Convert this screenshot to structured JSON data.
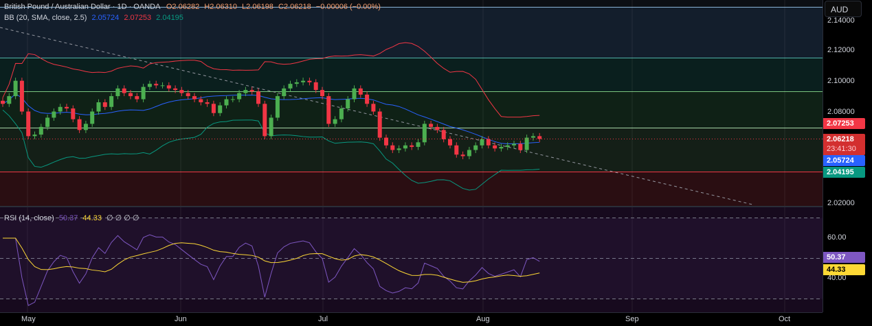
{
  "legend": {
    "title": "British Pound / Australian Dollar · 1D · OANDA",
    "open": "O2.06282",
    "high": "H2.06310",
    "low": "L2.06198",
    "close": "C2.06218",
    "change": "−0.00006 (−0.00%)",
    "bb_label": "BB (20, SMA, close, 2.5)",
    "bb_basis": "2.05724",
    "bb_upper": "2.07253",
    "bb_lower": "2.04195",
    "rsi_label": "RSI (14, close)",
    "rsi_value": "50.37",
    "rsi_ma": "44.33",
    "rsi_extra": "∅ ∅ ∅ ∅"
  },
  "currency_button": "AUD",
  "price_ticks": [
    "2.14000",
    "2.12000",
    "2.10000",
    "2.08000",
    "2.02000"
  ],
  "price_labels": {
    "upper": "2.07253",
    "last": "2.06218",
    "countdown": "23:41:30",
    "basis": "2.05724",
    "lower": "2.04195"
  },
  "rsi_ticks": [
    "60.00",
    "40.00"
  ],
  "rsi_labels": {
    "rsi": "50.37",
    "ma": "44.33"
  },
  "time_ticks": [
    "May",
    "Jun",
    "Jul",
    "Aug",
    "Sep",
    "Oct"
  ],
  "colors": {
    "up": "#4caf50",
    "down": "#f23645",
    "basis": "#2962ff",
    "upper": "#f23645",
    "lower": "#089981",
    "rsi": "#7e57c2",
    "rsi_ma": "#fdd835"
  },
  "closes": [
    2.085,
    2.09,
    2.1,
    2.08,
    2.064,
    2.065,
    2.07,
    2.076,
    2.08,
    2.083,
    2.082,
    2.075,
    2.068,
    2.072,
    2.08,
    2.086,
    2.083,
    2.09,
    2.095,
    2.092,
    2.09,
    2.088,
    2.096,
    2.098,
    2.097,
    2.097,
    2.095,
    2.094,
    2.092,
    2.09,
    2.088,
    2.086,
    2.085,
    2.079,
    2.084,
    2.088,
    2.088,
    2.092,
    2.094,
    2.093,
    2.085,
    2.064,
    2.076,
    2.09,
    2.095,
    2.098,
    2.099,
    2.1,
    2.099,
    2.094,
    2.09,
    2.072,
    2.075,
    2.082,
    2.088,
    2.095,
    2.091,
    2.085,
    2.08,
    2.063,
    2.058,
    2.055,
    2.056,
    2.058,
    2.057,
    2.06,
    2.072,
    2.07,
    2.068,
    2.062,
    2.058,
    2.052,
    2.051,
    2.055,
    2.058,
    2.062,
    2.058,
    2.056,
    2.057,
    2.058,
    2.059,
    2.055,
    2.063,
    2.064,
    2.06218
  ]
}
